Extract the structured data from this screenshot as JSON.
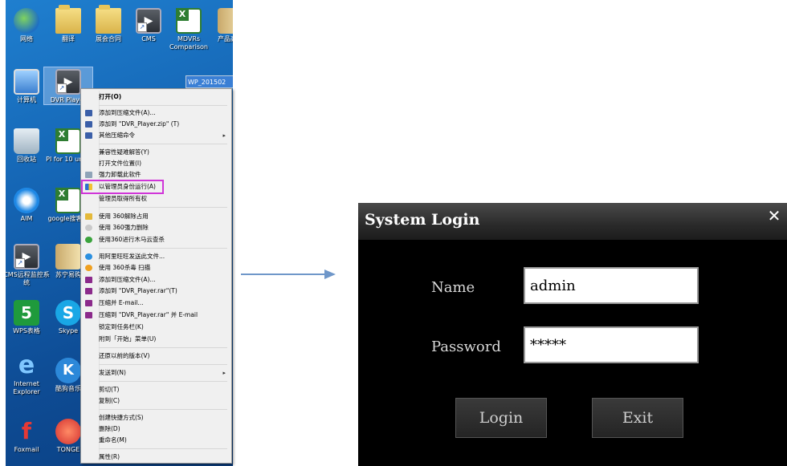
{
  "desktop": {
    "icons": [
      {
        "label": "网络",
        "icon": "network-icon"
      },
      {
        "label": "翻译",
        "icon": "folder-icon"
      },
      {
        "label": "展会合同",
        "icon": "folder-icon"
      },
      {
        "label": "CMS",
        "icon": "dvr-icon"
      },
      {
        "label": "MDVRs Comparison",
        "icon": "excel-icon"
      },
      {
        "label": "产品高片",
        "icon": "book-icon"
      },
      {
        "label": "计算机",
        "icon": "computer-icon"
      },
      {
        "label": "DVR Player",
        "icon": "dvr-icon"
      },
      {
        "label": "回收站",
        "icon": "recycle-bin-icon"
      },
      {
        "label": "PI for 10 units",
        "icon": "excel-icon"
      },
      {
        "label": "AIM",
        "icon": "aim-icon"
      },
      {
        "label": "google搜客户",
        "icon": "excel-icon"
      },
      {
        "label": "CMS远程监控系统",
        "icon": "dvr-icon"
      },
      {
        "label": "苏宁易购",
        "icon": "book-icon"
      },
      {
        "label": "WPS表格",
        "icon": "wps-icon"
      },
      {
        "label": "Skype",
        "icon": "skype-icon"
      },
      {
        "label": "Internet Explorer",
        "icon": "ie-icon"
      },
      {
        "label": "酷狗音乐",
        "icon": "kugou-icon"
      },
      {
        "label": "Foxmail",
        "icon": "foxmail-icon"
      },
      {
        "label": "TONGE",
        "icon": "tonge-icon"
      }
    ],
    "selected_file_label": "WP_201502"
  },
  "context_menu": {
    "items": [
      {
        "label": "打开(O)",
        "bold": true
      },
      {
        "label": "添加到压缩文件(A)..."
      },
      {
        "label": "添加到 \"DVR_Player.zip\" (T)"
      },
      {
        "label": "其他压缩命令",
        "submenu": true
      },
      {
        "label": "兼容性疑难解答(Y)"
      },
      {
        "label": "打开文件位置(I)"
      },
      {
        "label": "强力卸载此软件"
      },
      {
        "label": "以管理员身份运行(A)"
      },
      {
        "label": "管理员取得所有权"
      },
      {
        "label": "使用 360解除占用"
      },
      {
        "label": "使用 360强力删除"
      },
      {
        "label": "使用360进行木马云查杀"
      },
      {
        "label": "用阿里旺旺发送此文件..."
      },
      {
        "label": "使用 360杀毒 扫描"
      },
      {
        "label": "添加到压缩文件(A)..."
      },
      {
        "label": "添加到 \"DVR_Player.rar\"(T)"
      },
      {
        "label": "压缩并 E-mail..."
      },
      {
        "label": "压缩到 \"DVR_Player.rar\" 并 E-mail"
      },
      {
        "label": "锁定到任务栏(K)"
      },
      {
        "label": "附到「开始」菜单(U)"
      },
      {
        "label": "还原以前的版本(V)"
      },
      {
        "label": "发送到(N)",
        "submenu": true
      },
      {
        "label": "剪切(T)"
      },
      {
        "label": "复制(C)"
      },
      {
        "label": "创建快捷方式(S)"
      },
      {
        "label": "删除(D)"
      },
      {
        "label": "重命名(M)"
      },
      {
        "label": "属性(R)"
      }
    ],
    "submenu_arrow": "▸"
  },
  "login_dialog": {
    "title": "System Login",
    "close_glyph": "✕",
    "name_label": "Name",
    "name_value": "admin",
    "password_label": "Password",
    "password_value": "*****",
    "login_button": "Login",
    "exit_button": "Exit"
  },
  "colors": {
    "highlight_border": "#d036d8",
    "arrow": "#6f97c9",
    "dialog_background": "#000000"
  }
}
